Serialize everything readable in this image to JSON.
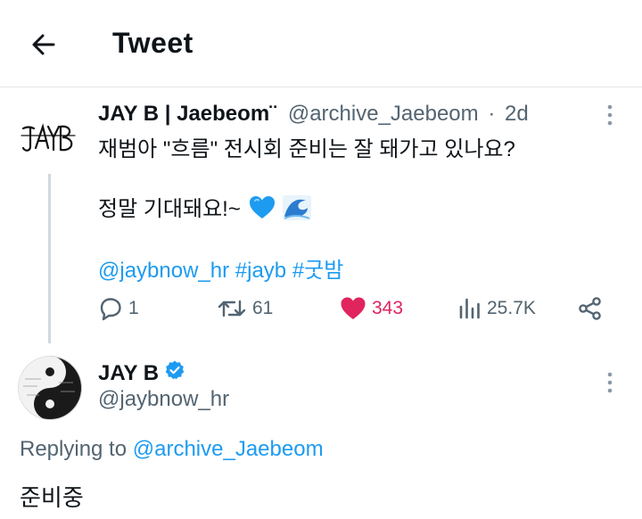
{
  "header": {
    "title": "Tweet"
  },
  "tweet1": {
    "avatar_logo_text": "JAYB",
    "display_name": "JAY B | Jaebeom¨",
    "handle": "@archive_Jaebeom",
    "separator": "·",
    "time": "2d",
    "line1": "재범아 \"흐름\" 전시회 준비는 잘 돼가고 있나요?",
    "line2": "정말 기대돼요!~",
    "mention": "@jaybnow_hr",
    "tag1": "#jayb",
    "tag2": "#굿밤",
    "stats": {
      "replies": "1",
      "retweets": "61",
      "likes": "343",
      "views": "25.7K"
    }
  },
  "tweet2": {
    "display_name": "JAY B",
    "handle": "@jaybnow_hr",
    "replying_prefix": "Replying to",
    "replying_to": "@archive_Jaebeom",
    "body": "준비중"
  },
  "colors": {
    "link": "#1d9bf0",
    "like": "#e0245e",
    "muted": "#536471",
    "verified": "#1d9bf0"
  }
}
